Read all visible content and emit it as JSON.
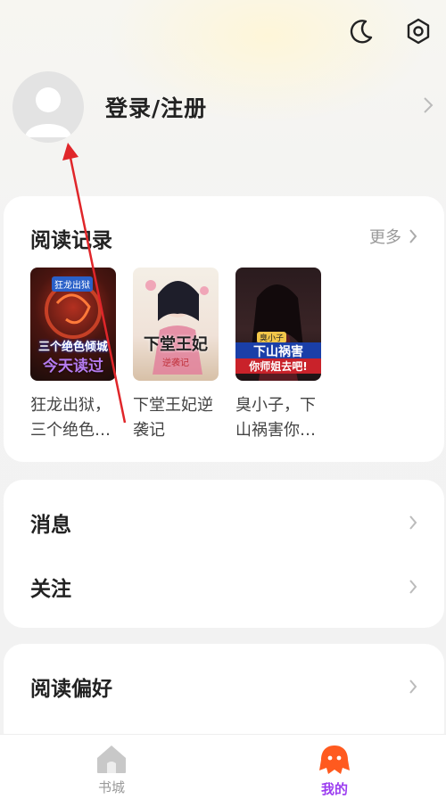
{
  "header": {
    "icons": [
      "moon-icon",
      "settings-icon"
    ]
  },
  "profile": {
    "login_label": "登录/注册"
  },
  "history": {
    "title": "阅读记录",
    "more_label": "更多",
    "books": [
      {
        "title": "狂龙出狱，三个绝色…",
        "badge": "今天读过",
        "cover_text": "三个绝色倾城",
        "cover_tag": "狂龙出狱"
      },
      {
        "title": "下堂王妃逆袭记",
        "cover_text": "下堂王妃",
        "cover_sub": "逆袭记"
      },
      {
        "title": "臭小子，下山祸害你…",
        "cover_text": "下山祸害",
        "cover_sub": "你师姐去吧!",
        "cover_tag": "臭小子"
      }
    ]
  },
  "menu": {
    "messages_label": "消息",
    "follow_label": "关注",
    "preference_label": "阅读偏好"
  },
  "tabbar": {
    "bookstore_label": "书城",
    "mine_label": "我的"
  },
  "colors": {
    "accent": "#9b3cf0",
    "mine_icon": "#ff5a1f",
    "annotation_arrow": "#e0262a"
  }
}
